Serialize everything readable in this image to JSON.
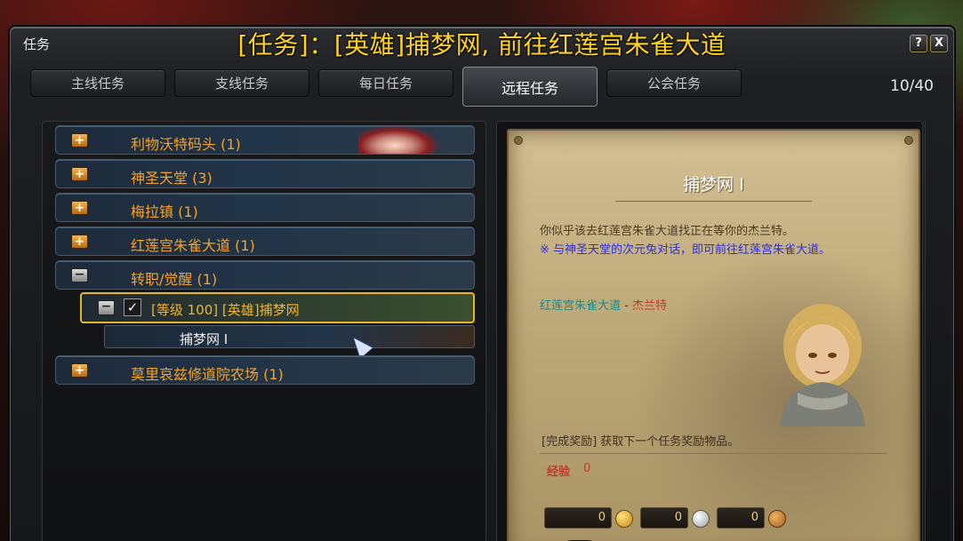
{
  "window": {
    "label": "任务",
    "quest_title": "[任务]：[英雄]捕梦网, 前往红莲宫朱雀大道",
    "help": "?",
    "close": "X"
  },
  "tabs": [
    {
      "label": "主线任务",
      "active": false
    },
    {
      "label": "支线任务",
      "active": false
    },
    {
      "label": "每日任务",
      "active": false
    },
    {
      "label": "远程任务",
      "active": true
    },
    {
      "label": "公会任务",
      "active": false
    }
  ],
  "quest_count": "10/40",
  "categories": [
    {
      "label": "利物沃特码头 (1)",
      "icon": "plus-icon"
    },
    {
      "label": "神圣天堂 (3)",
      "icon": "plus-icon"
    },
    {
      "label": "梅拉镇 (1)",
      "icon": "plus-icon"
    },
    {
      "label": "红莲宫朱雀大道 (1)",
      "icon": "plus-icon"
    },
    {
      "label": "转职/觉醒 (1)",
      "icon": "minus-icon"
    },
    {
      "label": "莫里哀兹修道院农场 (1)",
      "icon": "plus-icon"
    }
  ],
  "expanded_quest": {
    "label": "[等级 100] [英雄]捕梦网",
    "checked": true,
    "sub_item": "捕梦网 I"
  },
  "detail": {
    "title": "捕梦网 I",
    "description": "你似乎该去红莲宫朱雀大道找正在等你的杰兰特。",
    "note": "※ 与神圣天堂的次元兔对话，即可前往红莲宫朱雀大道。",
    "location": "红莲宫朱雀大道",
    "location_sep": " - ",
    "npc": "杰兰特",
    "reward_text": "[完成奖励] 获取下一个任务奖励物品。",
    "exp_label": "经验",
    "exp_value": "0",
    "gold": "0",
    "silver": "0",
    "bronze": "0"
  },
  "colors": {
    "title_yellow": "#ffd21f",
    "category_orange": "#f3a327",
    "quest_highlight": "#e3b62b",
    "note_blue": "#2f2fdc",
    "location_teal": "#1f8a86",
    "npc_red": "#c53b26"
  }
}
